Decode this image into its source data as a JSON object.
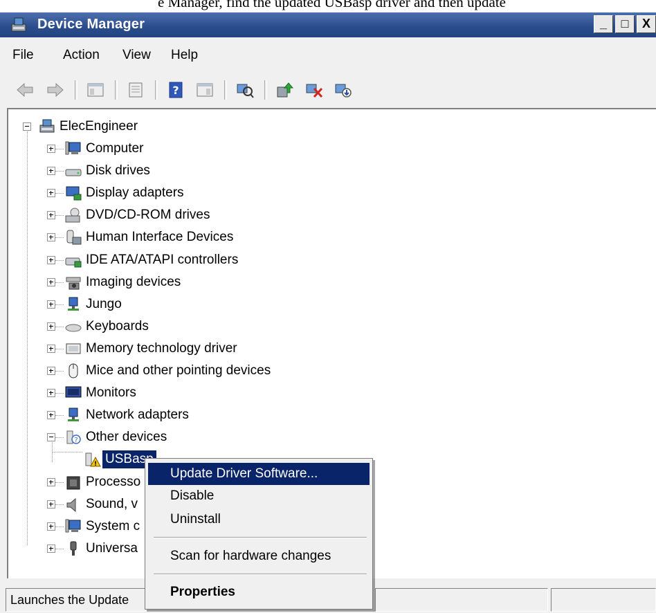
{
  "background_text": "e Manager, find the updated USBasp driver and then update",
  "window": {
    "title": "Device Manager",
    "caption_buttons": [
      "_",
      "□",
      "X"
    ]
  },
  "menu": [
    "File",
    "Action",
    "View",
    "Help"
  ],
  "toolbar_icons": [
    "back-icon",
    "forward-icon",
    "show-hide-console-tree-icon",
    "properties-icon",
    "help-icon",
    "show-action-pane-icon",
    "scan-hardware-icon",
    "update-driver-icon",
    "uninstall-icon",
    "disable-icon"
  ],
  "tree": {
    "root": "ElecEngineer",
    "items": [
      {
        "label": "Computer",
        "icon": "computer-icon"
      },
      {
        "label": "Disk drives",
        "icon": "disk-drive-icon"
      },
      {
        "label": "Display adapters",
        "icon": "display-adapter-icon"
      },
      {
        "label": "DVD/CD-ROM drives",
        "icon": "dvd-drive-icon"
      },
      {
        "label": "Human Interface Devices",
        "icon": "hid-icon"
      },
      {
        "label": "IDE ATA/ATAPI controllers",
        "icon": "ide-controller-icon"
      },
      {
        "label": "Imaging devices",
        "icon": "imaging-device-icon"
      },
      {
        "label": "Jungo",
        "icon": "jungo-icon"
      },
      {
        "label": "Keyboards",
        "icon": "keyboard-icon"
      },
      {
        "label": "Memory technology driver",
        "icon": "memory-driver-icon"
      },
      {
        "label": "Mice and other pointing devices",
        "icon": "mouse-icon"
      },
      {
        "label": "Monitors",
        "icon": "monitor-icon"
      },
      {
        "label": "Network adapters",
        "icon": "network-adapter-icon"
      },
      {
        "label": "Other devices",
        "icon": "unknown-device-icon"
      },
      {
        "label": "USBasp",
        "icon": "warning-device-icon"
      },
      {
        "label": "Processo",
        "icon": "processor-icon"
      },
      {
        "label": "Sound, v",
        "icon": "sound-icon"
      },
      {
        "label": "System c",
        "icon": "system-device-icon"
      },
      {
        "label": "Universa",
        "icon": "usb-icon"
      }
    ]
  },
  "context_menu": {
    "update": "Update Driver Software...",
    "disable": "Disable",
    "uninstall": "Uninstall",
    "scan": "Scan for hardware changes",
    "properties": "Properties"
  },
  "status": {
    "text": "Launches the Update"
  }
}
